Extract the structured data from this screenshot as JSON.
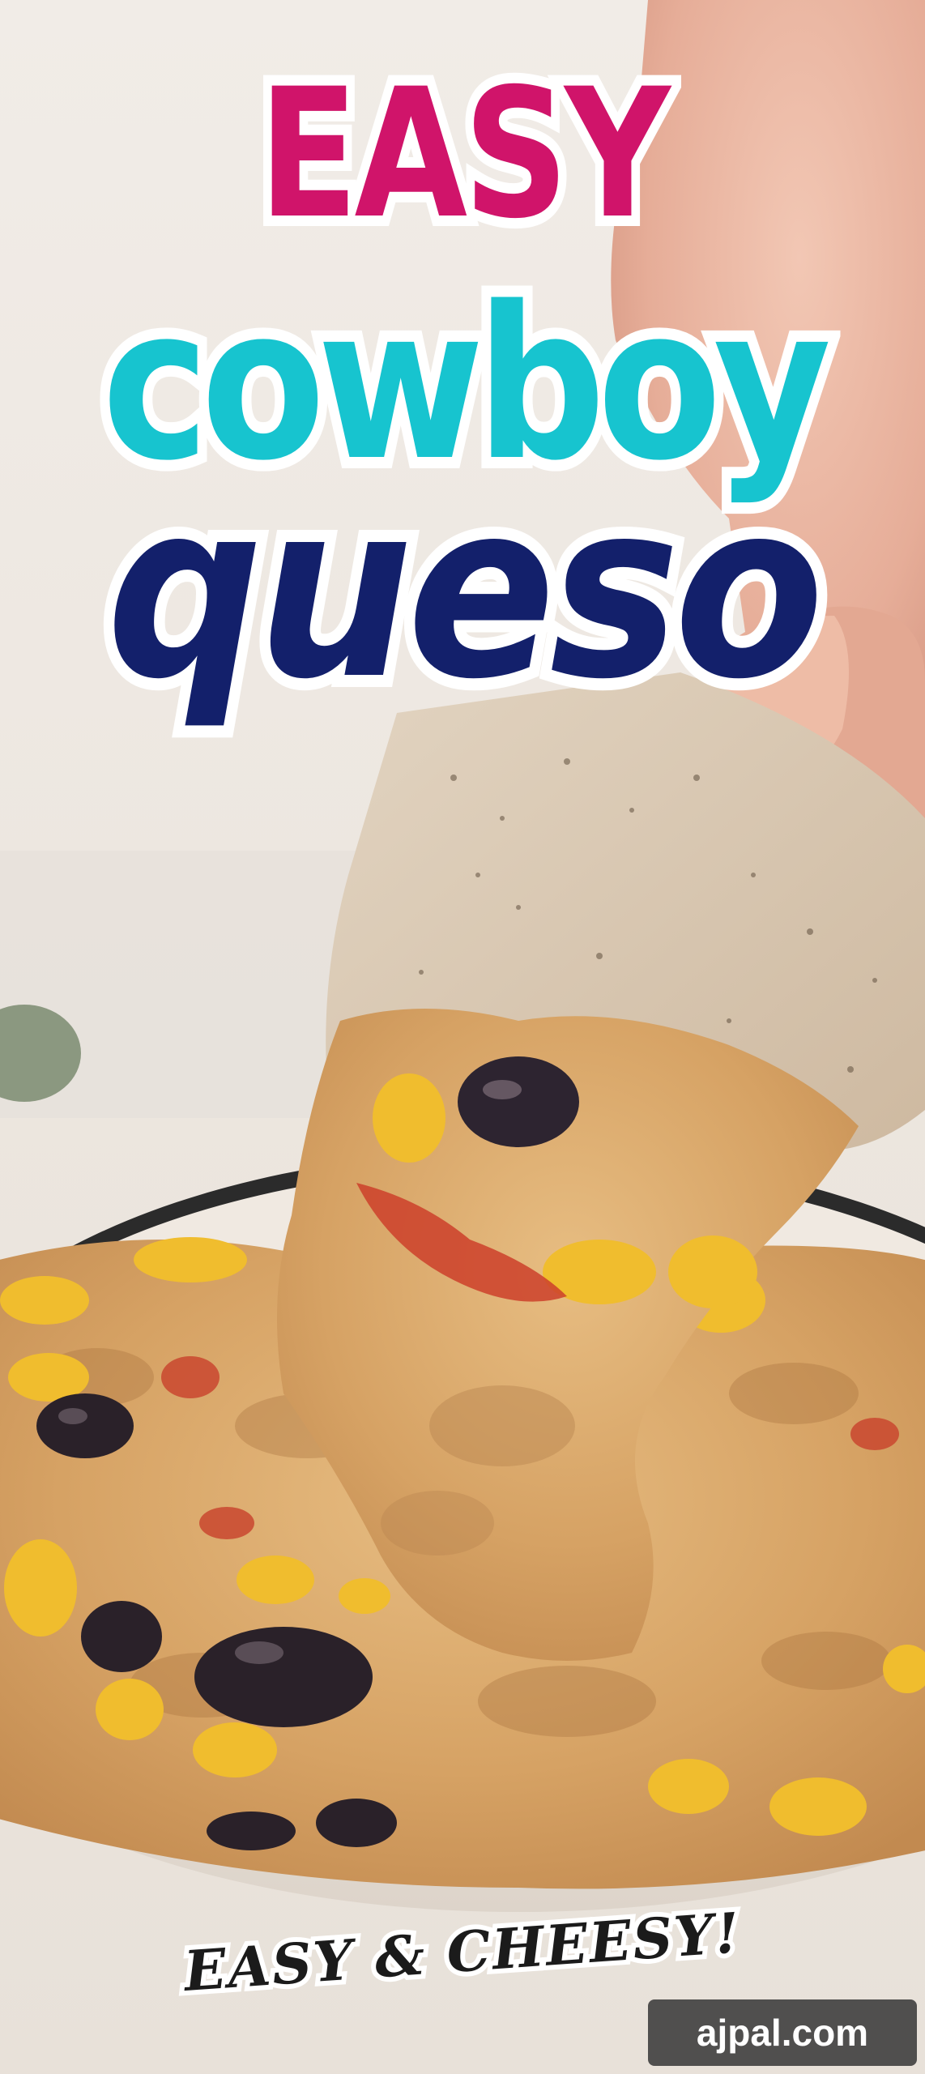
{
  "title": {
    "line1": "EASY",
    "line2": "cowboy",
    "line3": "queso"
  },
  "tagline": "EASY & CHEESY!",
  "watermark": "ajpal.com",
  "colors": {
    "title_line1": "#d0146a",
    "title_line2": "#17c4cf",
    "title_line3": "#13206b",
    "tagline": "#1b1b1b",
    "outline": "#ffffff",
    "watermark_bg": "#3a3a3a",
    "queso": "#d8a868",
    "chip": "#d9c9b4",
    "bowl_rim": "#2b2b2b"
  }
}
